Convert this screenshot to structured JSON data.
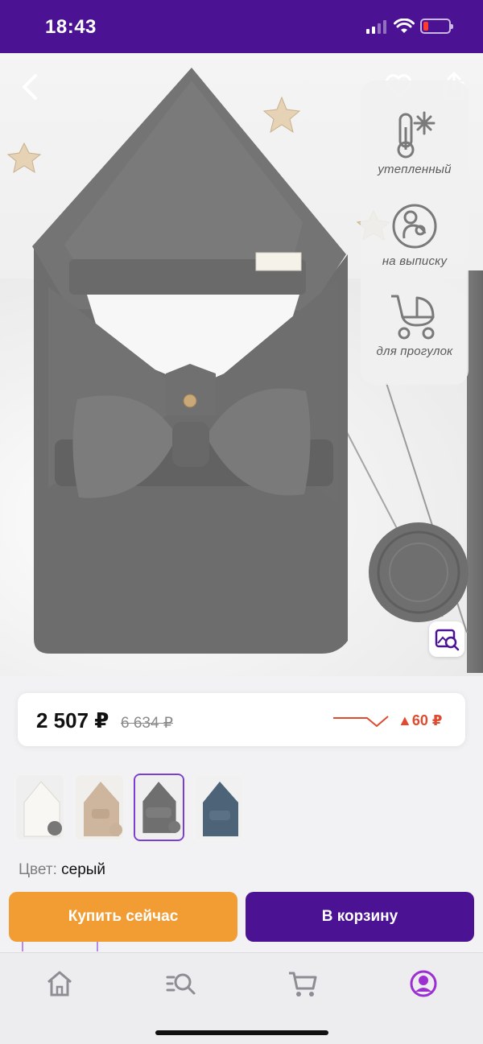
{
  "status_bar": {
    "time": "18:43"
  },
  "product": {
    "features": [
      {
        "icon": "snowflake-thermometer-icon",
        "label": "утепленный"
      },
      {
        "icon": "mother-baby-icon",
        "label": "на выписку"
      },
      {
        "icon": "stroller-icon",
        "label": "для прогулок"
      }
    ]
  },
  "price": {
    "current": "2 507 ₽",
    "old": "6 634 ₽",
    "change": "▲60 ₽",
    "trend_color": "#e04a2f"
  },
  "variants": [
    {
      "color_name": "white",
      "swatch": "#f4f2ef"
    },
    {
      "color_name": "beige",
      "swatch": "#cdb59e"
    },
    {
      "color_name": "grey",
      "swatch": "#6f6f6f",
      "selected": true
    },
    {
      "color_name": "blue",
      "swatch": "#4d6378"
    }
  ],
  "color_info": {
    "label": "Цвет:",
    "value": "серый"
  },
  "actions": {
    "buy_now": "Купить сейчас",
    "add_to_cart": "В корзину"
  },
  "nav": {
    "items": [
      {
        "icon": "home-icon"
      },
      {
        "icon": "catalog-search-icon"
      },
      {
        "icon": "cart-icon"
      },
      {
        "icon": "profile-icon",
        "active": true
      }
    ]
  },
  "colors": {
    "brand": "#4b1394",
    "accent_orange": "#f29d34",
    "active_nav": "#9b2fd1"
  }
}
